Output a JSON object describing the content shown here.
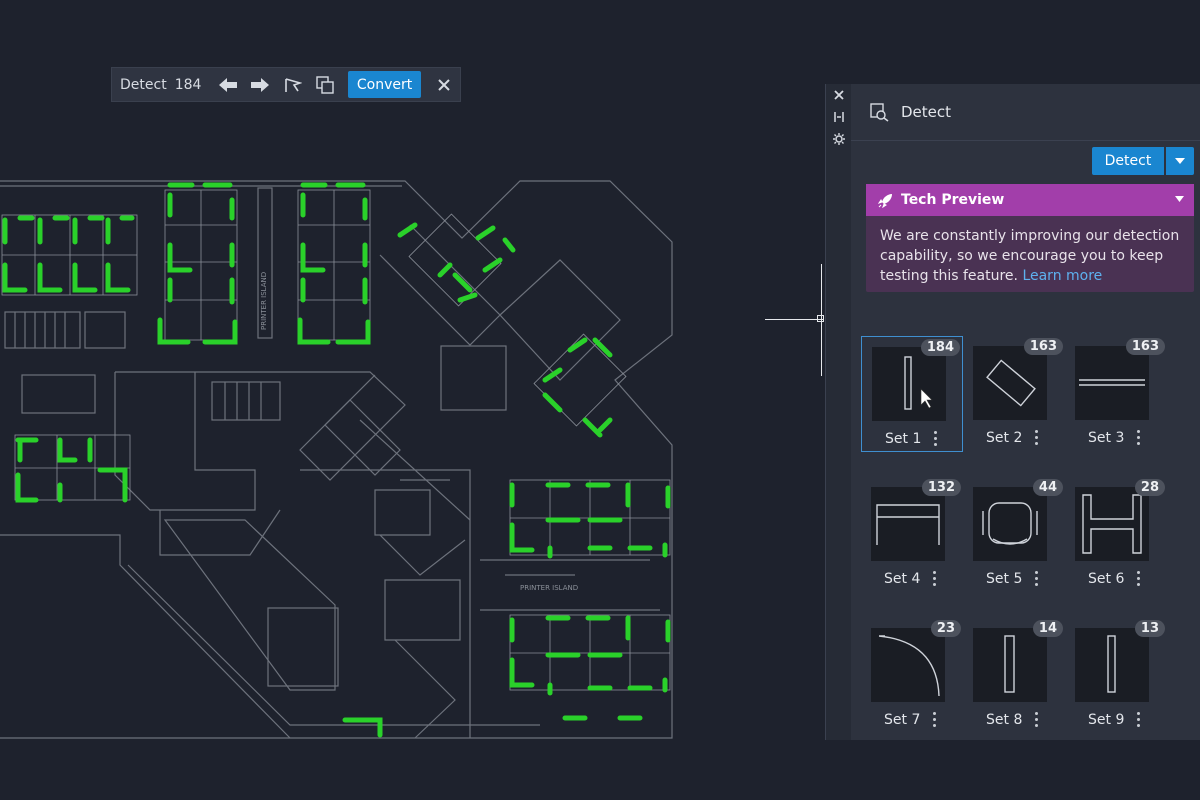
{
  "toolbar": {
    "label": "Detect",
    "count": "184",
    "convert_label": "Convert"
  },
  "panel": {
    "title": "Detect",
    "detect_button": "Detect",
    "preview": {
      "title": "Tech Preview",
      "body": "We are constantly improving our detection capability, so we encourage you to keep testing this feature.",
      "link": "Learn more"
    },
    "sets": [
      {
        "name": "Set 1",
        "count": "184",
        "shape": "vertical-bar"
      },
      {
        "name": "Set 2",
        "count": "163",
        "shape": "diamond"
      },
      {
        "name": "Set 3",
        "count": "163",
        "shape": "double-line"
      },
      {
        "name": "Set 4",
        "count": "132",
        "shape": "table"
      },
      {
        "name": "Set 5",
        "count": "44",
        "shape": "chair"
      },
      {
        "name": "Set 6",
        "count": "28",
        "shape": "h-shape"
      },
      {
        "name": "Set 7",
        "count": "23",
        "shape": "door-swing"
      },
      {
        "name": "Set 8",
        "count": "14",
        "shape": "vertical-bar"
      },
      {
        "name": "Set 9",
        "count": "13",
        "shape": "vertical-bar"
      }
    ]
  },
  "colors": {
    "accent": "#1a86d0",
    "preview_header": "#a23eaa",
    "preview_body": "#4a3253",
    "highlight": "#2ad12a",
    "link": "#5eb1ef"
  }
}
